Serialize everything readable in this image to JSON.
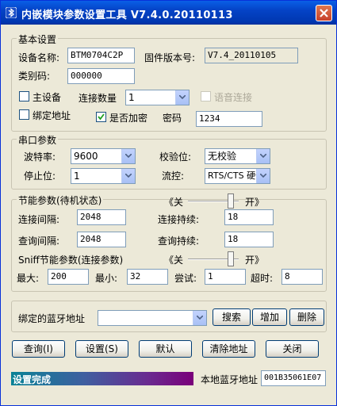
{
  "window": {
    "title": "内嵌模块参数设置工具 V7.4.0.20110113",
    "close_label": "X"
  },
  "basic": {
    "legend": "基本设置",
    "device_name_label": "设备名称:",
    "device_name_value": "BTM0704C2P",
    "firmware_label": "固件版本号:",
    "firmware_value": "V7.4_20110105",
    "class_code_label": "类别码:",
    "class_code_value": "000000",
    "master_label": "主设备",
    "master_checked": false,
    "conn_count_label": "连接数量",
    "conn_count_value": "1",
    "voice_label": "语音连接",
    "voice_checked": false,
    "bind_addr_label": "绑定地址",
    "bind_addr_checked": false,
    "encrypt_label": "是否加密",
    "encrypt_checked": true,
    "password_label": "密码",
    "password_value": "1234"
  },
  "serial": {
    "legend": "串口参数",
    "baud_label": "波特率:",
    "baud_value": "9600",
    "parity_label": "校验位:",
    "parity_value": "无校验",
    "stop_label": "停止位:",
    "stop_value": "1",
    "flow_label": "流控:",
    "flow_value": "RTS/CTS 硬件"
  },
  "power": {
    "legend": "节能参数(待机状态)",
    "off_label": "《关",
    "on_label": "开》",
    "conn_interval_label": "连接间隔:",
    "conn_interval_value": "2048",
    "conn_duration_label": "连接持续:",
    "conn_duration_value": "18",
    "query_interval_label": "查询间隔:",
    "query_interval_value": "2048",
    "query_duration_label": "查询持续:",
    "query_duration_value": "18"
  },
  "sniff": {
    "legend": "Sniff节能参数(连接参数)",
    "off_label": "《关",
    "on_label": "开》",
    "max_label": "最大:",
    "max_value": "200",
    "min_label": "最小:",
    "min_value": "32",
    "attempt_label": "尝试:",
    "attempt_value": "1",
    "timeout_label": "超时:",
    "timeout_value": "8"
  },
  "bound": {
    "label": "绑定的蓝牙地址",
    "value": "",
    "search_btn": "搜索",
    "add_btn": "增加",
    "delete_btn": "删除"
  },
  "actions": {
    "query_btn": "查询(I)",
    "set_btn": "设置(S)",
    "default_btn": "默认",
    "clear_btn": "清除地址",
    "close_btn": "关闭"
  },
  "status": {
    "text": "设置完成",
    "local_addr_label": "本地蓝牙地址",
    "local_addr_value": "001B35061E07"
  }
}
